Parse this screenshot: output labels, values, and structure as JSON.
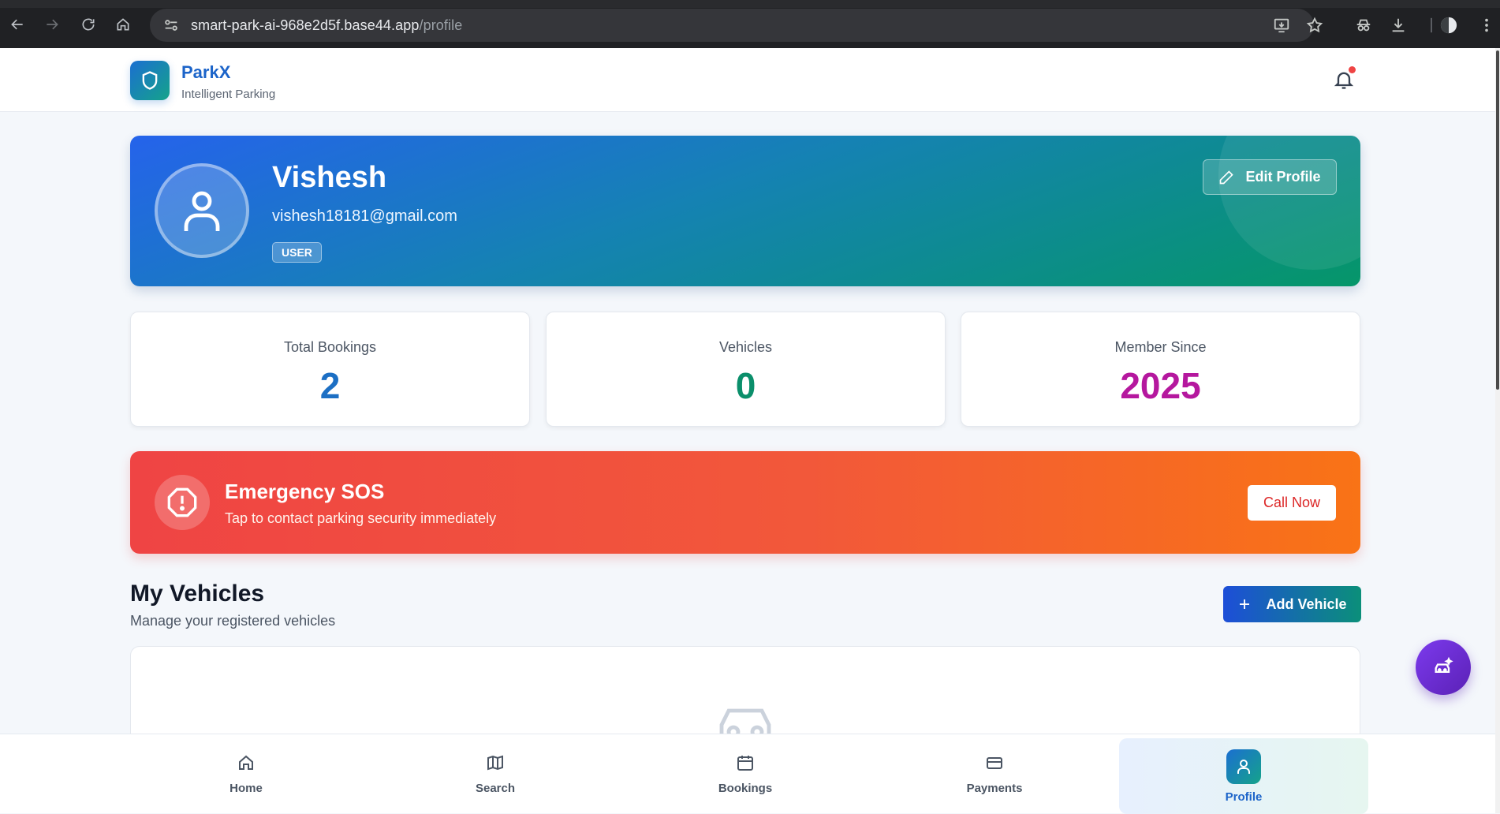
{
  "browser": {
    "url_host": "smart-park-ai-968e2d5f.base44.app",
    "url_path": "/profile"
  },
  "header": {
    "brand": "ParkX",
    "tagline": "Intelligent Parking"
  },
  "profile": {
    "name": "Vishesh",
    "email": "vishesh18181@gmail.com",
    "role": "USER",
    "edit_label": "Edit Profile"
  },
  "stats": [
    {
      "label": "Total Bookings",
      "value": "2",
      "color": "#1c6fc4"
    },
    {
      "label": "Vehicles",
      "value": "0",
      "color": "#0b8f6b"
    },
    {
      "label": "Member Since",
      "value": "2025",
      "color": "#b5179e"
    }
  ],
  "sos": {
    "title": "Emergency SOS",
    "subtitle": "Tap to contact parking security immediately",
    "button": "Call Now"
  },
  "vehicles": {
    "title": "My Vehicles",
    "subtitle": "Manage your registered vehicles",
    "add_label": "Add Vehicle"
  },
  "nav": [
    {
      "label": "Home",
      "icon": "home-icon"
    },
    {
      "label": "Search",
      "icon": "map-icon"
    },
    {
      "label": "Bookings",
      "icon": "calendar-icon"
    },
    {
      "label": "Payments",
      "icon": "credit-card-icon"
    },
    {
      "label": "Profile",
      "icon": "user-icon",
      "active": true
    }
  ],
  "colors": {
    "brand_blue": "#1c64c9",
    "brand_teal": "#15a38a",
    "sos_red": "#ef4444",
    "sos_orange": "#f97316",
    "ai_purple": "#7c3aed"
  }
}
